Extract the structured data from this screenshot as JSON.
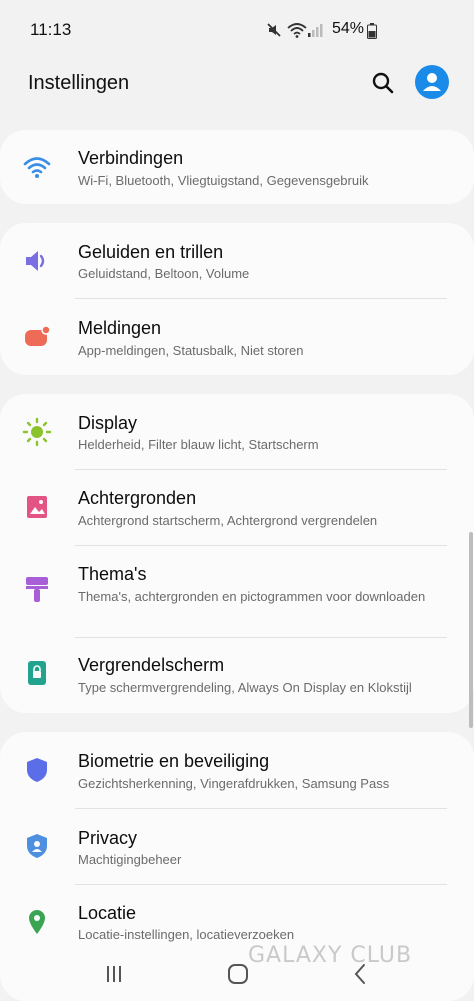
{
  "status_bar": {
    "time": "11:13",
    "battery": "54%"
  },
  "header": {
    "title": "Instellingen"
  },
  "items": [
    {
      "title": "Verbindingen",
      "subtitle": "Wi-Fi, Bluetooth, Vliegtuigstand, Gegevensgebruik",
      "icon": "wifi-icon",
      "color": "#3a8ee6"
    },
    {
      "title": "Geluiden en trillen",
      "subtitle": "Geluidstand, Beltoon, Volume",
      "icon": "speaker-icon",
      "color": "#7a6fe0"
    },
    {
      "title": "Meldingen",
      "subtitle": "App-meldingen, Statusbalk, Niet storen",
      "icon": "notification-icon",
      "color": "#ee6b57"
    },
    {
      "title": "Display",
      "subtitle": "Helderheid, Filter blauw licht, Startscherm",
      "icon": "brightness-icon",
      "color": "#8bc32a"
    },
    {
      "title": "Achtergronden",
      "subtitle": "Achtergrond startscherm, Achtergrond vergrendelen",
      "icon": "wallpaper-icon",
      "color": "#e35384"
    },
    {
      "title": "Thema's",
      "subtitle": "Thema's, achtergronden en pictogrammen voor downloaden",
      "icon": "theme-brush-icon",
      "color": "#a85ed6"
    },
    {
      "title": "Vergrendelscherm",
      "subtitle": "Type schermvergrendeling, Always On Display en Klokstijl",
      "icon": "lockscreen-icon",
      "color": "#21a38e"
    },
    {
      "title": "Biometrie en beveiliging",
      "subtitle": "Gezichtsherkenning, Vingerafdrukken, Samsung Pass",
      "icon": "shield-icon",
      "color": "#5b6ee8"
    },
    {
      "title": "Privacy",
      "subtitle": "Machtigingbeheer",
      "icon": "privacy-shield-icon",
      "color": "#4f8fe0"
    },
    {
      "title": "Locatie",
      "subtitle": "Locatie-instellingen, locatieverzoeken",
      "icon": "location-pin-icon",
      "color": "#3aa454"
    }
  ],
  "watermark": {
    "text": "GALAXY CLUB"
  }
}
